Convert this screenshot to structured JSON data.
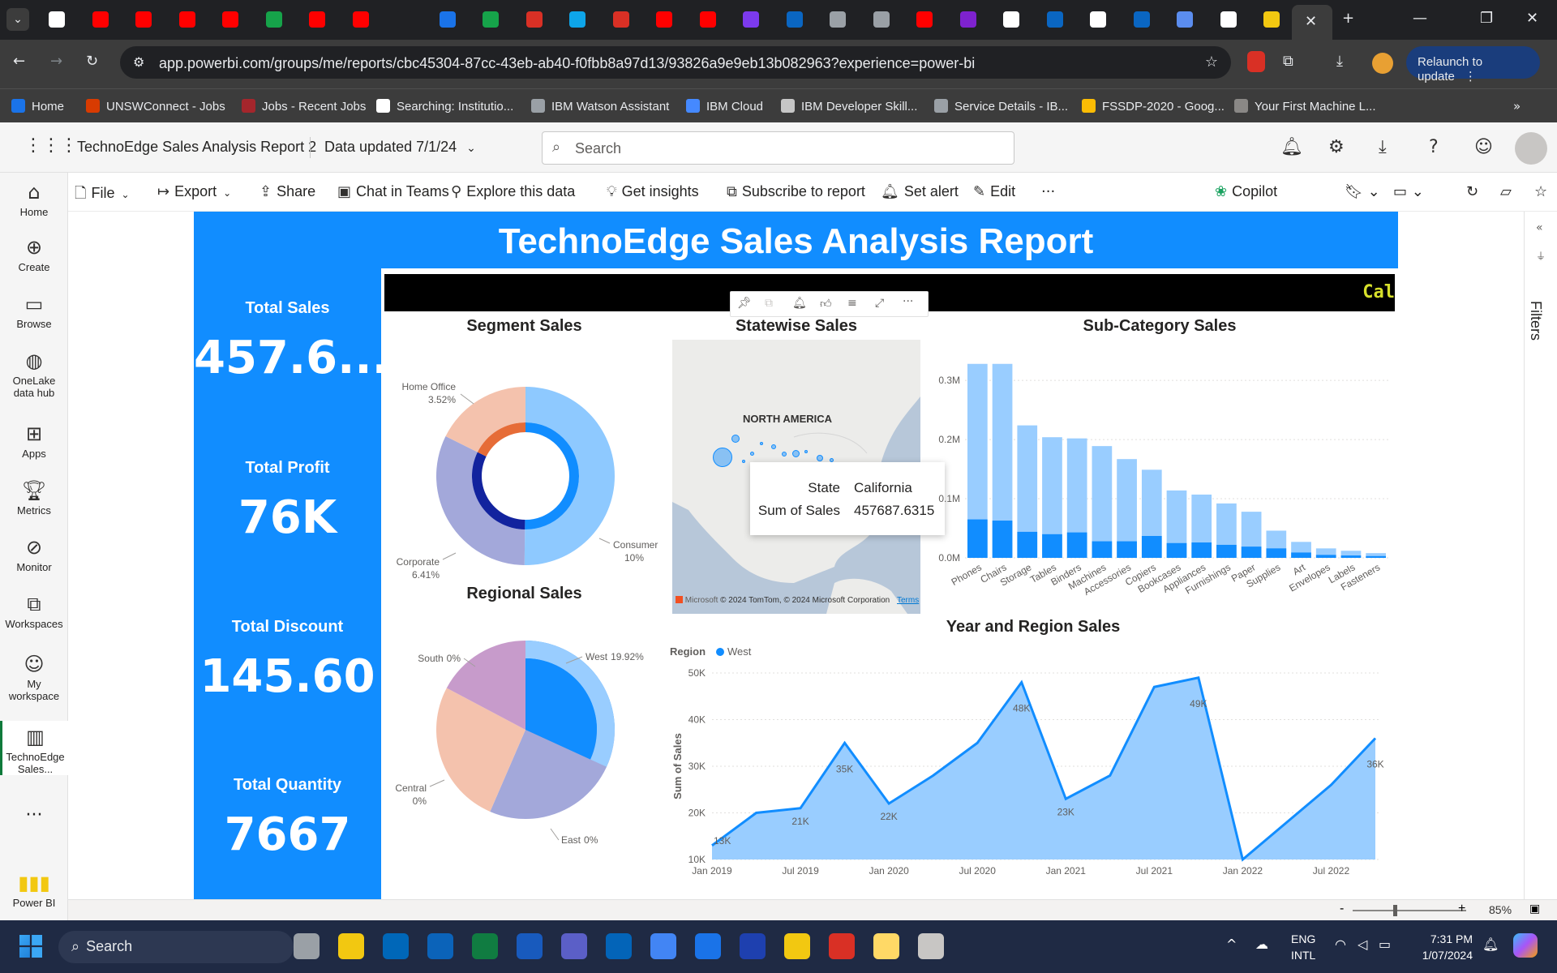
{
  "browser": {
    "url": "app.powerbi.com/groups/me/reports/cbc45304-87cc-43eb-ab40-f0fbb8a97d13/93826a9e9eb13b082963?experience=power-bi",
    "relaunch_label": "Relaunch to update",
    "bookmarks": [
      {
        "label": "Home",
        "color": "#1a73e8"
      },
      {
        "label": "UNSWConnect - Jobs",
        "color": "#d83b01"
      },
      {
        "label": "Jobs - Recent Jobs",
        "color": "#a4262c"
      },
      {
        "label": "Searching: Institutio...",
        "color": "#ffffff"
      },
      {
        "label": "IBM Watson Assistant",
        "color": "#9aa0a6"
      },
      {
        "label": "IBM Cloud",
        "color": "#4589ff"
      },
      {
        "label": "IBM Developer Skill...",
        "color": "#c6c6c6"
      },
      {
        "label": "Service Details - IB...",
        "color": "#9aa0a6"
      },
      {
        "label": "FSSDP-2020 - Goog...",
        "color": "#fbbc04"
      },
      {
        "label": "Your First Machine L...",
        "color": "#8a8886"
      }
    ]
  },
  "pbi": {
    "report_name": "TechnoEdge Sales Analysis Report 2",
    "data_updated": "Data updated 7/1/24",
    "search_placeholder": "Search",
    "actions": [
      "File",
      "Export",
      "Share",
      "Chat in Teams",
      "Explore this data",
      "Get insights",
      "Subscribe to report",
      "Set alert",
      "Edit"
    ],
    "copilot": "Copilot",
    "nav": [
      {
        "label": "Home",
        "icon": "home-icon"
      },
      {
        "label": "Create",
        "icon": "plus-circle-icon"
      },
      {
        "label": "Browse",
        "icon": "folder-icon"
      },
      {
        "label": "OneLake\ndata hub",
        "icon": "onelake-icon"
      },
      {
        "label": "Apps",
        "icon": "apps-icon"
      },
      {
        "label": "Metrics",
        "icon": "trophy-icon"
      },
      {
        "label": "Monitor",
        "icon": "monitor-icon"
      },
      {
        "label": "Workspaces",
        "icon": "workspaces-icon"
      },
      {
        "label": "My\nworkspace",
        "icon": "person-icon"
      },
      {
        "label": "TechnoEdge\nSales...",
        "icon": "report-icon"
      }
    ],
    "powerbi_label": "Power BI",
    "filters_label": "Filters",
    "zoom": "85%"
  },
  "report": {
    "title": "TechnoEdge Sales Analysis Report",
    "ticker": "Cal",
    "kpis": [
      {
        "label": "Total Sales",
        "value": "457.6..."
      },
      {
        "label": "Total Profit",
        "value": "76K"
      },
      {
        "label": "Total Discount",
        "value": "145.60"
      },
      {
        "label": "Total Quantity",
        "value": "7667"
      }
    ],
    "segment_title": "Segment Sales",
    "regional_title": "Regional Sales",
    "state_title": "Statewise Sales",
    "subcat_title": "Sub-Category Sales",
    "year_title": "Year and Region Sales",
    "map": {
      "label": "NORTH AMERICA",
      "copyright": "© 2024 TomTom, © 2024 Microsoft Corporation",
      "terms": "Terms",
      "microsoft": "Microsoft"
    },
    "tooltip": {
      "k1": "State",
      "v1": "California",
      "k2": "Sum of Sales",
      "v2": "457687.6315"
    }
  },
  "chart_data": [
    {
      "type": "pie",
      "title": "Segment Sales",
      "subtype": "donut",
      "slices": [
        {
          "label": "Consumer",
          "display": "10%",
          "value": 10,
          "color": "#8ec9ff"
        },
        {
          "label": "Corporate",
          "display": "6.41%",
          "value": 6.41,
          "color": "#a3a8da"
        },
        {
          "label": "Home Office",
          "display": "3.52%",
          "value": 3.52,
          "color": "#f4c2ad"
        }
      ],
      "inner": [
        {
          "value": 10,
          "color": "#118dff"
        },
        {
          "value": 6.41,
          "color": "#12239e"
        },
        {
          "value": 3.52,
          "color": "#e66c37"
        }
      ]
    },
    {
      "type": "pie",
      "title": "Regional Sales",
      "slices": [
        {
          "label": "West",
          "display": "19.92%",
          "value": 19.92,
          "color": "#118dff"
        },
        {
          "label": "East",
          "display": "0%",
          "value": 0,
          "color": "#a3a8da"
        },
        {
          "label": "Central",
          "display": "0%",
          "value": 0,
          "color": "#f4c2ad"
        },
        {
          "label": "South",
          "display": "0%",
          "value": 0,
          "color": "#c79bcb"
        }
      ]
    },
    {
      "type": "bar",
      "title": "Sub-Category Sales",
      "categories": [
        "Phones",
        "Chairs",
        "Storage",
        "Tables",
        "Binders",
        "Machines",
        "Accessories",
        "Copiers",
        "Bookcases",
        "Appliances",
        "Furnishings",
        "Paper",
        "Supplies",
        "Art",
        "Envelopes",
        "Labels",
        "Fasteners"
      ],
      "series": [
        {
          "name": "Total",
          "values": [
            0.328,
            0.328,
            0.224,
            0.204,
            0.202,
            0.189,
            0.167,
            0.149,
            0.114,
            0.107,
            0.092,
            0.078,
            0.046,
            0.027,
            0.016,
            0.012,
            0.008
          ],
          "color": "#99cdff"
        },
        {
          "name": "Selected",
          "values": [
            0.065,
            0.063,
            0.044,
            0.04,
            0.043,
            0.028,
            0.028,
            0.037,
            0.025,
            0.026,
            0.022,
            0.019,
            0.016,
            0.009,
            0.005,
            0.004,
            0.003
          ],
          "color": "#118dff"
        }
      ],
      "yticks": [
        "0.0M",
        "0.1M",
        "0.2M",
        "0.3M"
      ],
      "ylim": [
        0,
        0.34
      ]
    },
    {
      "type": "area",
      "title": "Year and Region Sales",
      "legend_title": "Region",
      "series_name": "West",
      "ylabel": "Sum of Sales",
      "x": [
        "Jan 2019",
        "Apr 2019",
        "Jul 2019",
        "Oct 2019",
        "Jan 2020",
        "Apr 2020",
        "Jul 2020",
        "Oct 2020",
        "Jan 2021",
        "Apr 2021",
        "Jul 2021",
        "Oct 2021",
        "Jan 2022",
        "Apr 2022",
        "Jul 2022",
        "Oct 2022"
      ],
      "values": [
        13,
        20,
        21,
        35,
        22,
        28,
        35,
        48,
        23,
        28,
        47,
        49,
        10,
        18,
        26,
        36
      ],
      "labels": [
        "13K",
        "",
        "21K",
        "35K",
        "22K",
        "",
        "",
        "48K",
        "23K",
        "",
        "",
        "49K",
        "",
        "",
        "",
        "36K"
      ],
      "xticks": [
        "Jan 2019",
        "Jul 2019",
        "Jan 2020",
        "Jul 2020",
        "Jan 2021",
        "Jul 2021",
        "Jan 2022",
        "Jul 2022"
      ],
      "yticks": [
        "10K",
        "20K",
        "30K",
        "40K",
        "50K"
      ],
      "ylim": [
        10,
        50
      ]
    }
  ],
  "taskbar": {
    "search": "Search",
    "lang1": "ENG",
    "lang2": "INTL",
    "time": "7:31 PM",
    "date": "1/07/2024"
  }
}
